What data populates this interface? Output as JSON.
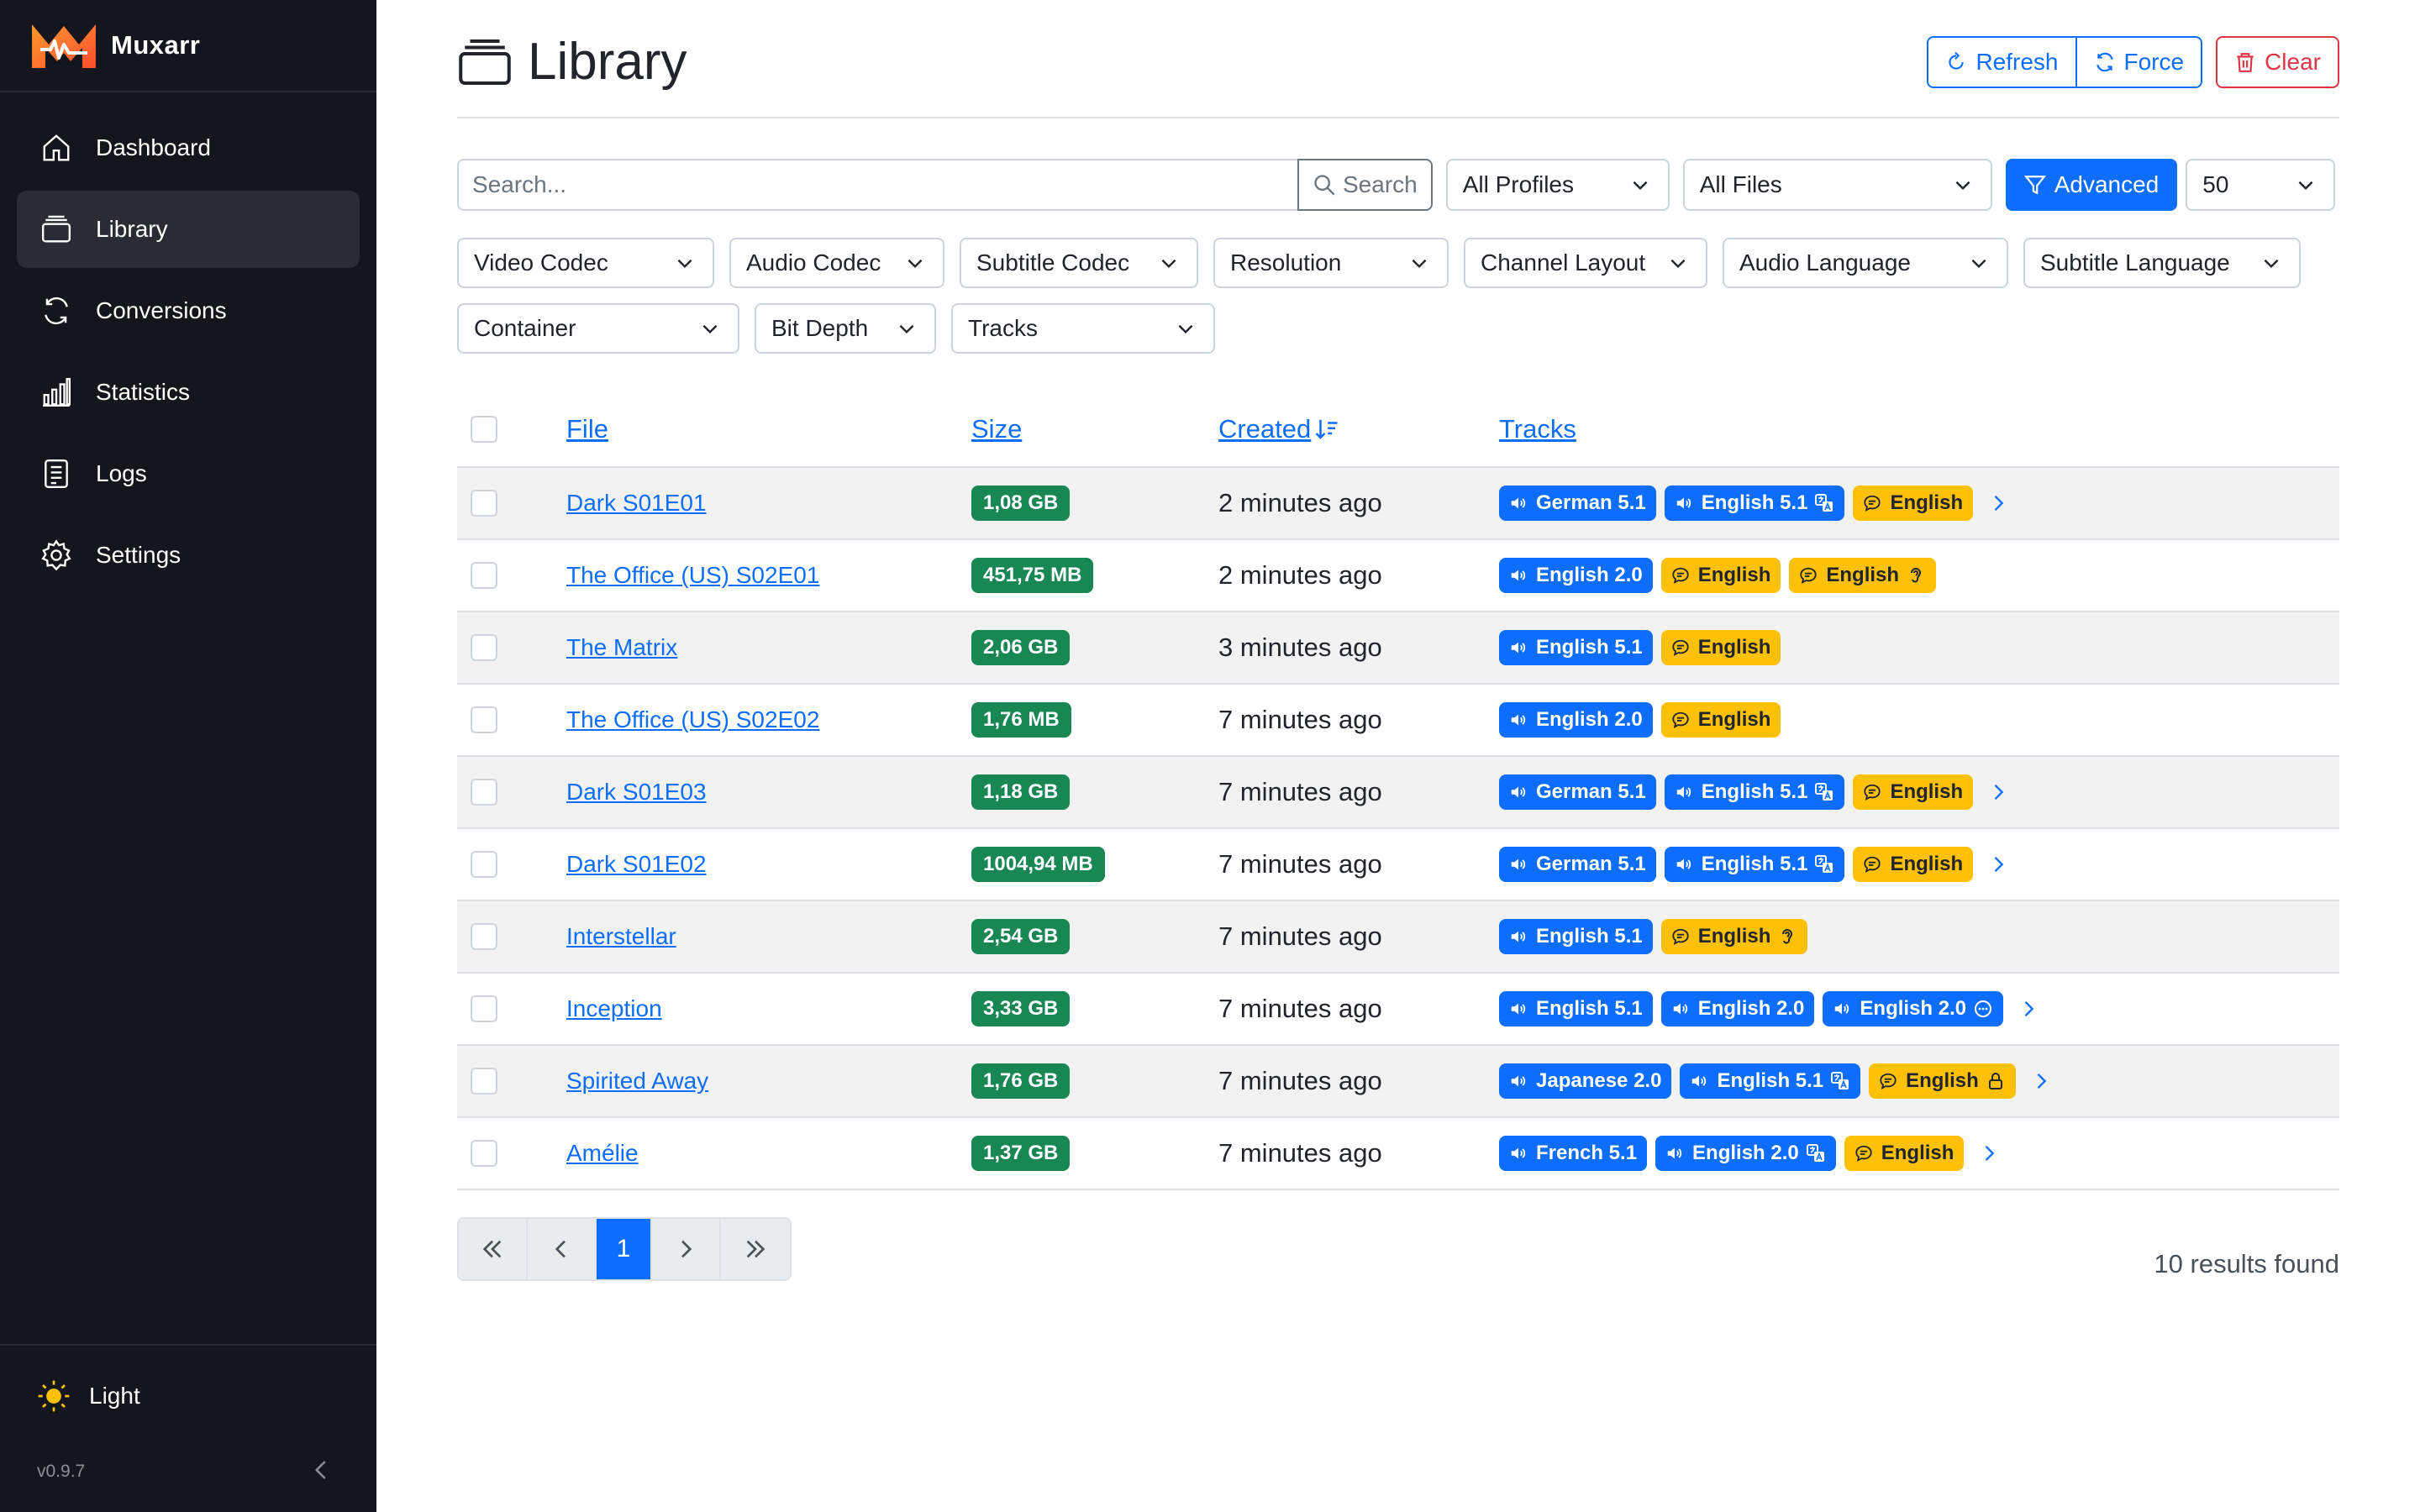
{
  "app": {
    "name": "Muxarr",
    "version": "v0.9.7"
  },
  "nav": [
    {
      "label": "Dashboard",
      "icon": "home-icon"
    },
    {
      "label": "Library",
      "icon": "library-icon"
    },
    {
      "label": "Conversions",
      "icon": "sync-icon"
    },
    {
      "label": "Statistics",
      "icon": "bar-chart-icon"
    },
    {
      "label": "Logs",
      "icon": "logs-icon"
    },
    {
      "label": "Settings",
      "icon": "gear-icon"
    }
  ],
  "theme": {
    "label": "Light",
    "icon": "sun-icon"
  },
  "page": {
    "title": "Library"
  },
  "actions": {
    "refresh": "Refresh",
    "force": "Force",
    "clear": "Clear"
  },
  "filters": {
    "search_placeholder": "Search...",
    "search_button": "Search",
    "profile": "All Profiles",
    "files": "All Files",
    "advanced": "Advanced",
    "page_size": "50"
  },
  "advanced_filters": [
    "Video Codec",
    "Audio Codec",
    "Subtitle Codec",
    "Resolution",
    "Channel Layout",
    "Audio Language",
    "Subtitle Language",
    "Container",
    "Bit Depth",
    "Tracks"
  ],
  "table": {
    "headers": {
      "file": "File",
      "size": "Size",
      "created": "Created",
      "tracks": "Tracks"
    },
    "rows": [
      {
        "file": "Dark S01E01",
        "size": "1,08 GB",
        "created": "2 minutes ago",
        "tracks": [
          {
            "type": "audio",
            "label": "German 5.1"
          },
          {
            "type": "audio",
            "label": "English 5.1",
            "flag": "translate-icon"
          },
          {
            "type": "sub",
            "label": "English"
          }
        ],
        "more": true
      },
      {
        "file": "The Office (US) S02E01",
        "size": "451,75 MB",
        "created": "2 minutes ago",
        "tracks": [
          {
            "type": "audio",
            "label": "English 2.0"
          },
          {
            "type": "sub",
            "label": "English"
          },
          {
            "type": "sub",
            "label": "English",
            "flag": "ear-icon"
          }
        ],
        "more": false
      },
      {
        "file": "The Matrix",
        "size": "2,06 GB",
        "created": "3 minutes ago",
        "tracks": [
          {
            "type": "audio",
            "label": "English 5.1"
          },
          {
            "type": "sub",
            "label": "English"
          }
        ],
        "more": false
      },
      {
        "file": "The Office (US) S02E02",
        "size": "1,76 MB",
        "created": "7 minutes ago",
        "tracks": [
          {
            "type": "audio",
            "label": "English 2.0"
          },
          {
            "type": "sub",
            "label": "English"
          }
        ],
        "more": false
      },
      {
        "file": "Dark S01E03",
        "size": "1,18 GB",
        "created": "7 minutes ago",
        "tracks": [
          {
            "type": "audio",
            "label": "German 5.1"
          },
          {
            "type": "audio",
            "label": "English 5.1",
            "flag": "translate-icon"
          },
          {
            "type": "sub",
            "label": "English"
          }
        ],
        "more": true
      },
      {
        "file": "Dark S01E02",
        "size": "1004,94 MB",
        "created": "7 minutes ago",
        "tracks": [
          {
            "type": "audio",
            "label": "German 5.1"
          },
          {
            "type": "audio",
            "label": "English 5.1",
            "flag": "translate-icon"
          },
          {
            "type": "sub",
            "label": "English"
          }
        ],
        "more": true
      },
      {
        "file": "Interstellar",
        "size": "2,54 GB",
        "created": "7 minutes ago",
        "tracks": [
          {
            "type": "audio",
            "label": "English 5.1"
          },
          {
            "type": "sub",
            "label": "English",
            "flag": "ear-icon"
          }
        ],
        "more": false
      },
      {
        "file": "Inception",
        "size": "3,33 GB",
        "created": "7 minutes ago",
        "tracks": [
          {
            "type": "audio",
            "label": "English 5.1"
          },
          {
            "type": "audio",
            "label": "English 2.0"
          },
          {
            "type": "audio",
            "label": "English 2.0",
            "flag": "commentary-icon"
          }
        ],
        "more": true
      },
      {
        "file": "Spirited Away",
        "size": "1,76 GB",
        "created": "7 minutes ago",
        "tracks": [
          {
            "type": "audio",
            "label": "Japanese 2.0"
          },
          {
            "type": "audio",
            "label": "English 5.1",
            "flag": "translate-icon"
          },
          {
            "type": "sub",
            "label": "English",
            "flag": "lock-icon"
          }
        ],
        "more": true
      },
      {
        "file": "Amélie",
        "size": "1,37 GB",
        "created": "7 minutes ago",
        "tracks": [
          {
            "type": "audio",
            "label": "French 5.1"
          },
          {
            "type": "audio",
            "label": "English 2.0",
            "flag": "translate-icon"
          },
          {
            "type": "sub",
            "label": "English"
          }
        ],
        "more": true
      }
    ]
  },
  "pagination": {
    "current": "1"
  },
  "results": "10 results found",
  "colors": {
    "primary": "#0d6efd",
    "success": "#198754",
    "warning": "#ffc107",
    "danger": "#dc3545",
    "sidebar": "#15161d"
  }
}
